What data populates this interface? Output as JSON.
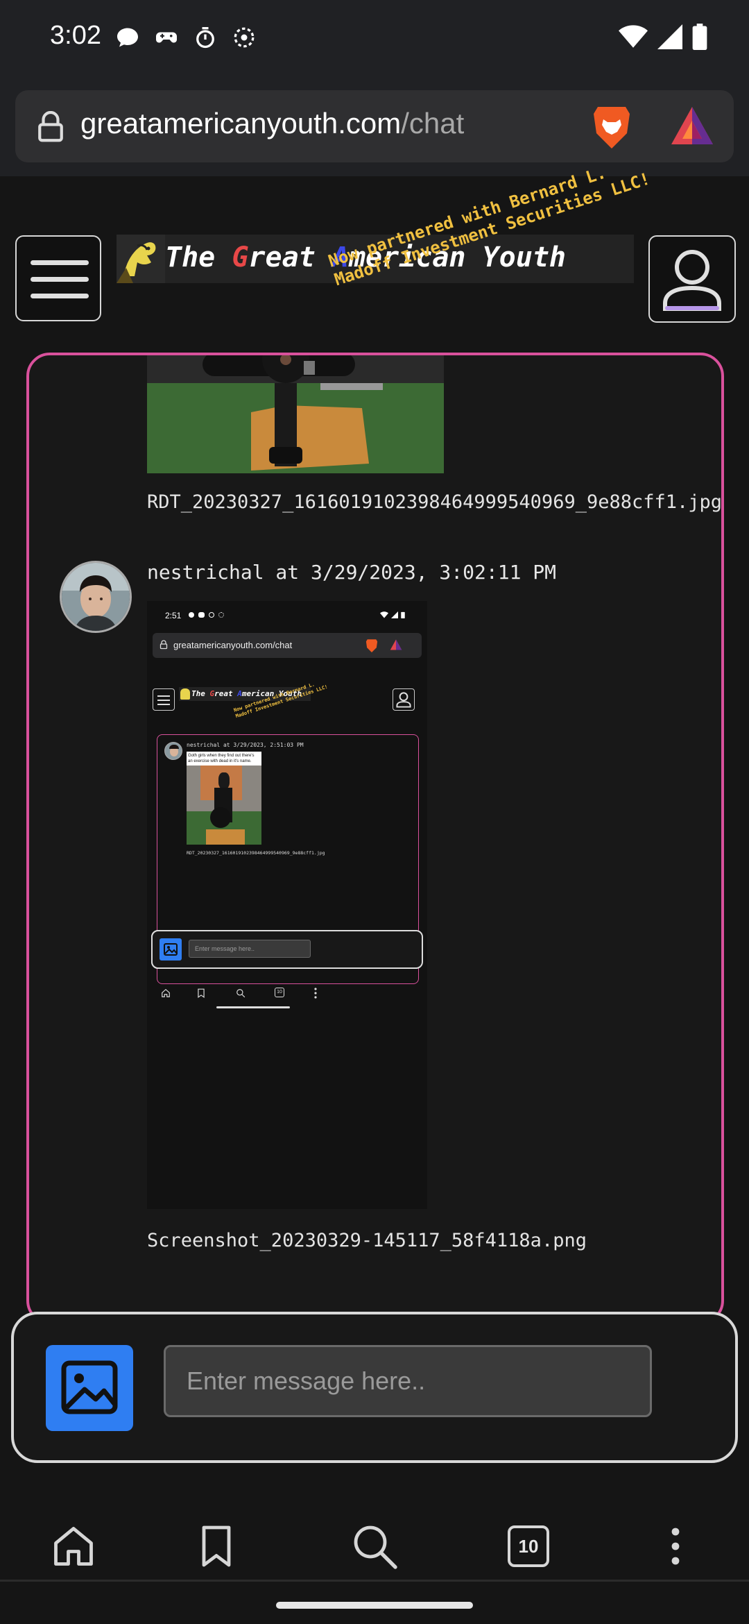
{
  "status_bar": {
    "time": "3:02",
    "left_icons": [
      "chat-bubble-icon",
      "game-controller-icon",
      "timer-icon",
      "spinner-icon"
    ],
    "right_icons": [
      "wifi-icon",
      "cell-signal-icon",
      "battery-icon"
    ]
  },
  "browser": {
    "url_domain": "greatamericanyouth.com",
    "url_path": "/chat",
    "icons": [
      "lock-icon",
      "brave-lion-icon",
      "bat-triangle-icon"
    ]
  },
  "header": {
    "logo_prefix": "The ",
    "logo_g": "G",
    "logo_reat": "reat ",
    "logo_a": "A",
    "logo_merican": "merican Youth",
    "promo_line1": "Now partnered with Bernard L.",
    "promo_line2": "Madoff Investment Securities LLC!"
  },
  "chat": {
    "previous_attachment_filename": "RDT_20230327_161601910239846499954096​9_9e88cff1.jpg",
    "message": {
      "author": "nestrichal",
      "timestamp_text": "nestrichal at 3/29/2023, 3:02:11 PM",
      "attachment_filename": "Screenshot_20230329-145117_58f4118a.png"
    },
    "embedded_screenshot": {
      "time": "2:51",
      "url": "greatamericanyouth.com/chat",
      "logo_prefix": "The ",
      "logo_g": "G",
      "logo_reat": "reat ",
      "logo_a": "A",
      "logo_merican": "merican Youth",
      "promo_line1": "Now partnered with Bernard L.",
      "promo_line2": "Madoff Investment Securities LLC!",
      "msg_header": "nestrichal at 3/29/2023, 2:51:03 PM",
      "meme_line1": "Goth girls when they find out there's",
      "meme_line2": "an exercise with dead in it's name.",
      "filename": "RDT_20230327_161601910239846499954096​9_9e88cff1.jpg",
      "input_placeholder": "Enter message here..",
      "tab_count": "10"
    }
  },
  "composer": {
    "placeholder": "Enter message here.."
  },
  "bottom_nav": {
    "tab_count": "10",
    "items": [
      "home-icon",
      "bookmark-icon",
      "search-icon",
      "tabs-icon",
      "more-icon"
    ]
  },
  "colors": {
    "panel_border": "#d9519c",
    "accent_blue": "#2f7ef2",
    "logo_red": "#e84848",
    "logo_blue": "#3c48e8",
    "promo_yellow": "#f0c040"
  }
}
